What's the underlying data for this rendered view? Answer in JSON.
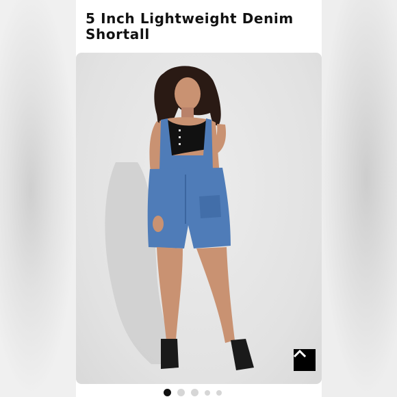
{
  "product": {
    "title": "5 Inch Lightweight Denim Shortall"
  },
  "image": {
    "icon": "model-wearing-denim-shortall",
    "colors": {
      "denim": "#4f7cb8",
      "denim_dark": "#3b659f",
      "skin": "#c99272",
      "hair": "#2a1a14",
      "top": "#111111",
      "shoes": "#1a1a1a"
    }
  },
  "controls": {
    "scroll_top_icon": "chevron-up-icon",
    "zoom_icon": "hand-pinch-zoom-icon"
  },
  "carousel": {
    "total": 5,
    "active_index": 0
  }
}
